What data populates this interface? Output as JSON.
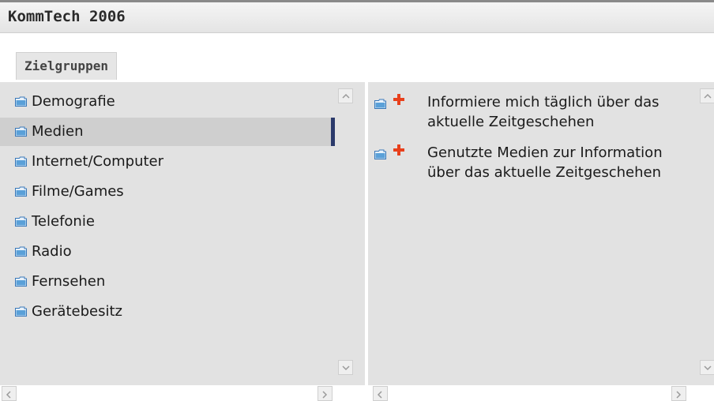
{
  "window": {
    "title": "KommTech 2006"
  },
  "tabs": [
    {
      "label": "Zielgruppen"
    }
  ],
  "categories": [
    {
      "label": "Demografie",
      "selected": false
    },
    {
      "label": "Medien",
      "selected": true
    },
    {
      "label": "Internet/Computer",
      "selected": false
    },
    {
      "label": "Filme/Games",
      "selected": false
    },
    {
      "label": "Telefonie",
      "selected": false
    },
    {
      "label": "Radio",
      "selected": false
    },
    {
      "label": "Fernsehen",
      "selected": false
    },
    {
      "label": "Gerätebesitz",
      "selected": false
    }
  ],
  "subitems": [
    {
      "label": "Informiere mich täglich über das aktuelle Zeitgeschehen"
    },
    {
      "label": "Genutzte Medien zur Information über das aktuelle Zeitgeschehen"
    }
  ],
  "icons": {
    "folder": "folder-icon",
    "add": "plus-icon",
    "scroll_up": "chevron-up-icon",
    "scroll_down": "chevron-down-icon",
    "scroll_left": "chevron-left-icon",
    "scroll_right": "chevron-right-icon"
  },
  "colors": {
    "selection_marker": "#2b3a6b",
    "plus": "#e8401c",
    "folder": "#5aa0d8",
    "pane_bg": "#e2e2e2"
  }
}
